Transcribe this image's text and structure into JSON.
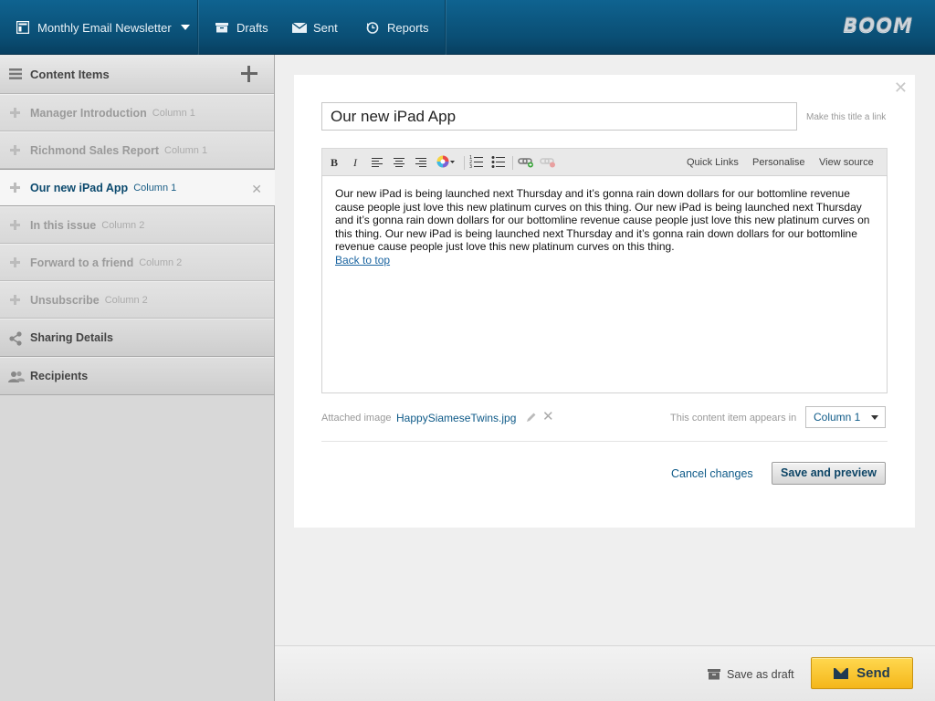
{
  "header": {
    "newsletter_name": "Monthly Email Newsletter",
    "nav": [
      {
        "label": "Drafts",
        "icon": "archive-icon"
      },
      {
        "label": "Sent",
        "icon": "envelope-icon"
      },
      {
        "label": "Reports",
        "icon": "history-icon"
      }
    ],
    "logo": "BOOM"
  },
  "sidebar": {
    "content_items_title": "Content Items",
    "items": [
      {
        "name": "Manager Introduction",
        "column": "Column 1",
        "active": false
      },
      {
        "name": "Richmond Sales Report",
        "column": "Column 1",
        "active": false
      },
      {
        "name": "Our new iPad App",
        "column": "Column 1",
        "active": true
      },
      {
        "name": "In this issue",
        "column": "Column 2",
        "active": false
      },
      {
        "name": "Forward to a friend",
        "column": "Column 2",
        "active": false
      },
      {
        "name": "Unsubscribe",
        "column": "Column 2",
        "active": false
      }
    ],
    "sections": [
      {
        "label": "Sharing Details",
        "icon": "share-icon"
      },
      {
        "label": "Recipients",
        "icon": "users-icon"
      }
    ]
  },
  "editor": {
    "title_value": "Our new iPad App",
    "title_link_hint": "Make this title a link",
    "toolbar": {
      "bold": "B",
      "italic": "I",
      "quick_links": "Quick Links",
      "personalise": "Personalise",
      "view_source": "View source"
    },
    "body_text": "Our new iPad is being launched next Thursday and it’s gonna rain down dollars for our bottomline revenue cause people just love this new platinum curves on this thing. Our new iPad is being launched next Thursday and it’s gonna rain down dollars for our bottomline revenue cause people just love this new platinum curves on this thing. Our new iPad is being launched next Thursday and it’s gonna rain down dollars for our bottomline revenue cause people just love this new platinum curves on this thing.",
    "back_to_top": "Back to top",
    "attached_image_label": "Attached image",
    "attached_image_file": "HappySiameseTwins.jpg",
    "appears_in_label": "This content item appears in",
    "column_select": "Column 1",
    "cancel_label": "Cancel changes",
    "save_preview_label": "Save and preview"
  },
  "footer": {
    "save_draft_label": "Save as draft",
    "send_label": "Send"
  },
  "colors": {
    "header_bg": "#0a4e74",
    "accent_link": "#0e5a88",
    "send_button": "#f4b61a"
  }
}
